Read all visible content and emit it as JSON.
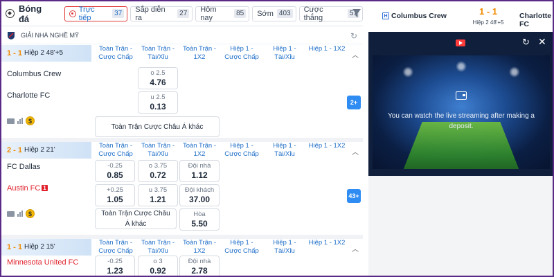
{
  "header": {
    "sport_title": "Bóng đá",
    "tabs": [
      {
        "label": "Trực tiếp",
        "count": "37"
      },
      {
        "label": "Sắp diễn ra",
        "count": "27"
      },
      {
        "label": "Hôm nay",
        "count": "85"
      },
      {
        "label": "Sớm",
        "count": "403"
      },
      {
        "label": "Cược thắng",
        "count": "57"
      }
    ]
  },
  "league": {
    "name": "GIẢI NHÀ NGHỀ MỸ"
  },
  "column_headers": {
    "c1": "Toàn Trận - Cược Chấp",
    "c2": "Toàn Trận - Tài/Xỉu",
    "c3": "Toàn Trận - 1X2",
    "c4": "Hiệp 1 - Cược Chấp",
    "c5": "Hiệp 1 - Tài/Xỉu",
    "c6": "Hiệp 1 - 1X2"
  },
  "matches": [
    {
      "score": "1 - 1",
      "time": "Hiệp 2 48'+5",
      "home": "Columbus Crew",
      "away": "Charlotte FC",
      "home_ou": {
        "label": "o 2.5",
        "value": "4.76"
      },
      "away_ou": {
        "label": "u 2.5",
        "value": "0.13"
      },
      "more_label": "Toàn Trận Cược Châu Á khác",
      "more_count": "2+"
    },
    {
      "score": "2 - 1",
      "time": "Hiệp 2 21'",
      "home": "FC Dallas",
      "away": "Austin FC",
      "away_redcard": "1",
      "home_hdp": {
        "label": "-0.25",
        "value": "0.85"
      },
      "home_ou": {
        "label": "o 3.75",
        "value": "0.72"
      },
      "home_1x2": {
        "label": "Đội nhà",
        "value": "1.12"
      },
      "away_hdp": {
        "label": "+0.25",
        "value": "1.05"
      },
      "away_ou": {
        "label": "u 3.75",
        "value": "1.21"
      },
      "away_1x2": {
        "label": "Đội khách",
        "value": "37.00"
      },
      "draw_1x2": {
        "label": "Hòa",
        "value": "5.50"
      },
      "more_label": "Toàn Trận Cược Châu Á khác",
      "more_count": "43+"
    },
    {
      "score": "1 - 1",
      "time": "Hiệp 2 15'",
      "home": "Minnesota United FC",
      "home_hdp": {
        "label": "-0.25",
        "value": "1.23"
      },
      "home_ou": {
        "label": "o 3",
        "value": "0.92"
      },
      "home_1x2": {
        "label": "Đội nhà",
        "value": "2.78"
      }
    }
  ],
  "side_panel": {
    "home": "Columbus Crew",
    "away": "Charlotte FC",
    "score": "1 - 1",
    "time": "Hiệp 2 48'+5",
    "home_badge": "H",
    "stream_message": "You can watch the live streaming after making a deposit."
  },
  "colors": {
    "accent_blue": "#1e6ec8",
    "score_orange": "#f08a00",
    "live_red": "#e03a3a",
    "frame_purple": "#5b2a86"
  },
  "icons": [
    "football-icon",
    "live-icon",
    "filter-icon",
    "mls-logo",
    "refresh-icon",
    "tv-icon",
    "stats-icon",
    "coin-icon",
    "youtube-icon",
    "close-icon",
    "wallet-icon"
  ]
}
